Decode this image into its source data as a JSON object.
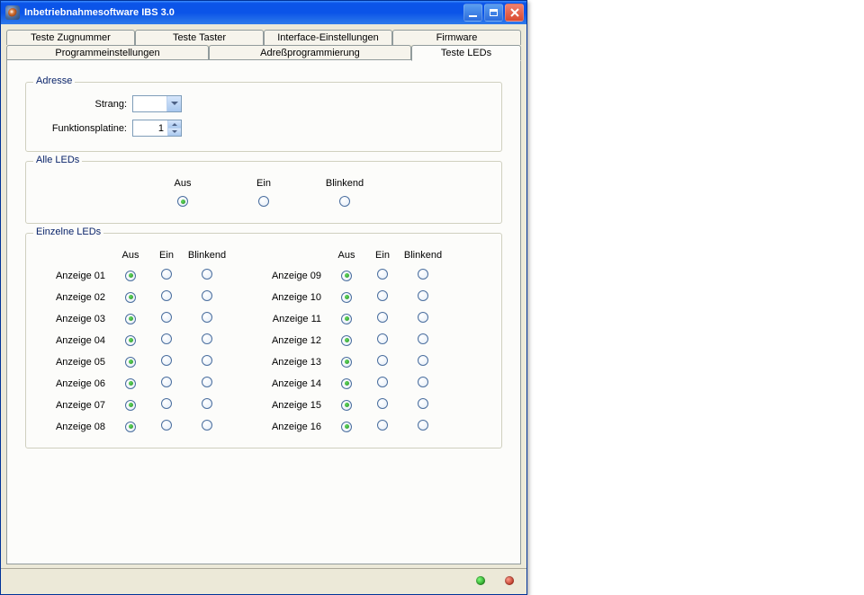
{
  "window": {
    "title": "Inbetriebnahmesoftware IBS 3.0"
  },
  "tabs_row1": {
    "t0": "Teste Zugnummer",
    "t1": "Teste Taster",
    "t2": "Interface-Einstellungen",
    "t3": "Firmware"
  },
  "tabs_row2": {
    "t0": "Programmeinstellungen",
    "t1": "Adreßprogrammierung",
    "t2": "Teste LEDs"
  },
  "adresse": {
    "legend": "Adresse",
    "strang_label": "Strang:",
    "strang_value": "",
    "platine_label": "Funktionsplatine:",
    "platine_value": "1"
  },
  "alle": {
    "legend": "Alle LEDs",
    "aus": "Aus",
    "ein": "Ein",
    "blinkend": "Blinkend",
    "selected": "aus"
  },
  "einzelne": {
    "legend": "Einzelne LEDs",
    "hdr_aus": "Aus",
    "hdr_ein": "Ein",
    "hdr_blinkend": "Blinkend",
    "left": {
      "r1": "Anzeige 01",
      "r2": "Anzeige 02",
      "r3": "Anzeige 03",
      "r4": "Anzeige 04",
      "r5": "Anzeige 05",
      "r6": "Anzeige 06",
      "r7": "Anzeige 07",
      "r8": "Anzeige 08"
    },
    "right": {
      "r1": "Anzeige 09",
      "r2": "Anzeige 10",
      "r3": "Anzeige 11",
      "r4": "Anzeige 12",
      "r5": "Anzeige 13",
      "r6": "Anzeige 14",
      "r7": "Anzeige 15",
      "r8": "Anzeige 16"
    }
  }
}
